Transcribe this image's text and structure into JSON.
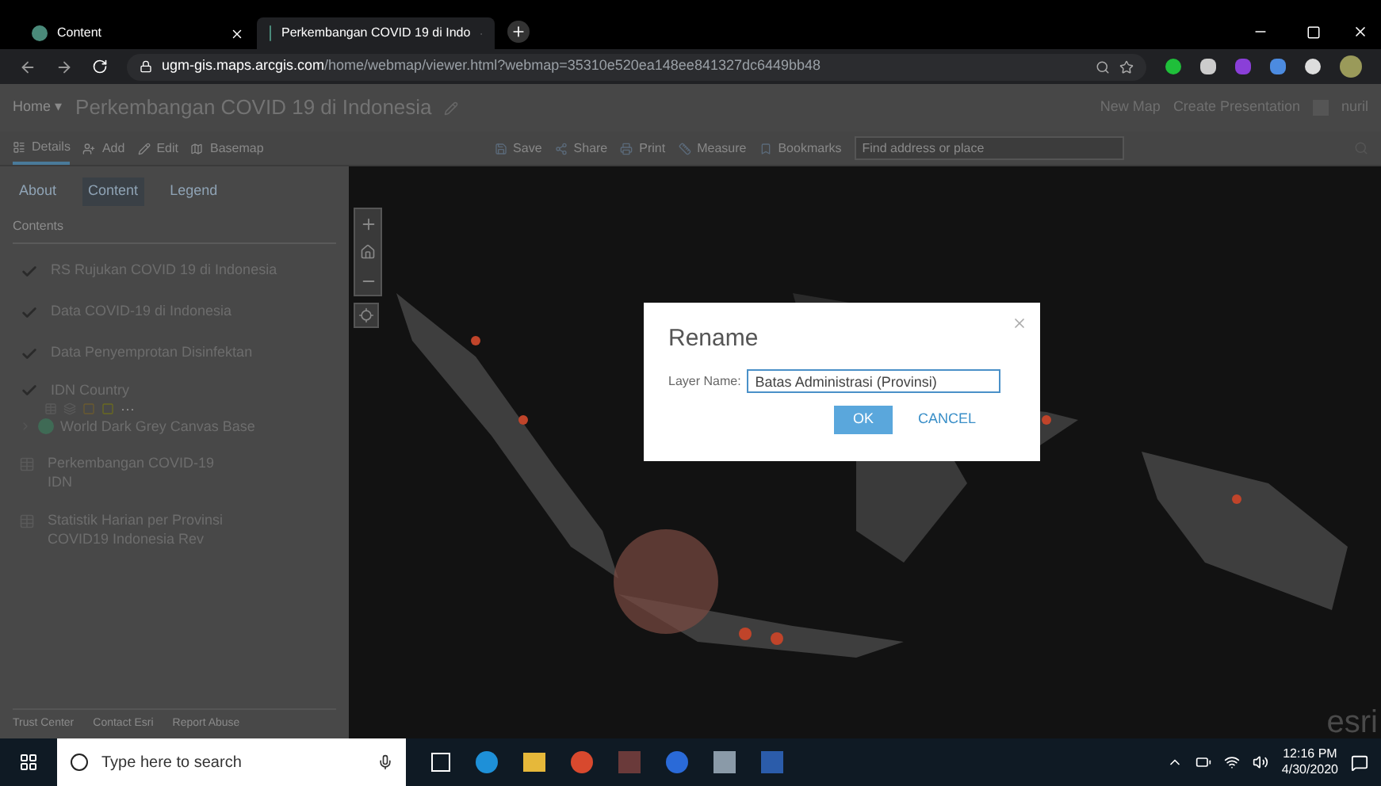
{
  "browser": {
    "tabs": [
      {
        "title": "Content",
        "selected": false
      },
      {
        "title": "Perkembangan COVID 19 di Indo",
        "selected": true
      }
    ],
    "url_host": "ugm-gis.maps.arcgis.com",
    "url_path": "/home/webmap/viewer.html?webmap=35310e520ea148ee841327dc6449bb48"
  },
  "header": {
    "home": "Home",
    "home_caret": "▾",
    "title": "Perkembangan COVID 19 di Indonesia",
    "links": [
      "New Map",
      "Create Presentation"
    ],
    "user": "nuril"
  },
  "toolbar": {
    "left": [
      {
        "label": "Details",
        "selected": true
      },
      {
        "label": "Add",
        "selected": false
      },
      {
        "label": "Edit",
        "selected": false
      },
      {
        "label": "Basemap",
        "selected": false
      }
    ],
    "right": [
      {
        "label": "Save"
      },
      {
        "label": "Share"
      },
      {
        "label": "Print"
      },
      {
        "label": "Measure"
      },
      {
        "label": "Bookmarks"
      }
    ],
    "search_placeholder": "Find address or place"
  },
  "panel": {
    "tabs": [
      {
        "label": "About",
        "selected": false
      },
      {
        "label": "Content",
        "selected": true
      },
      {
        "label": "Legend",
        "selected": false
      }
    ],
    "heading": "Contents",
    "layers": [
      {
        "kind": "check",
        "name": "RS Rujukan COVID 19 di Indonesia",
        "checked": true
      },
      {
        "kind": "check",
        "name": "Data COVID-19 di Indonesia",
        "checked": true
      },
      {
        "kind": "check",
        "name": "Data Penyemprotan Disinfektan",
        "checked": true
      },
      {
        "kind": "group",
        "name": "IDN Country",
        "checked": true,
        "more": "···",
        "children": [
          {
            "name": "World Dark Grey Canvas Base",
            "expanded": false
          }
        ]
      },
      {
        "kind": "table",
        "name": "Perkembangan COVID-19 IDN"
      },
      {
        "kind": "table",
        "name": "Statistik Harian per Provinsi COVID19 Indonesia Rev"
      }
    ],
    "footer": [
      "Trust Center",
      "Contact Esri",
      "Report Abuse"
    ]
  },
  "map": {
    "attribution": "esri"
  },
  "dialog": {
    "title": "Rename",
    "field_label": "Layer Name:",
    "value": "Batas Administrasi (Provinsi)",
    "buttons": [
      {
        "label": "OK",
        "kind": "primary"
      },
      {
        "label": "CANCEL",
        "kind": "link"
      }
    ]
  },
  "taskbar": {
    "search_placeholder": "Type here to search",
    "time": "12:16 PM",
    "date": "4/30/2020"
  }
}
